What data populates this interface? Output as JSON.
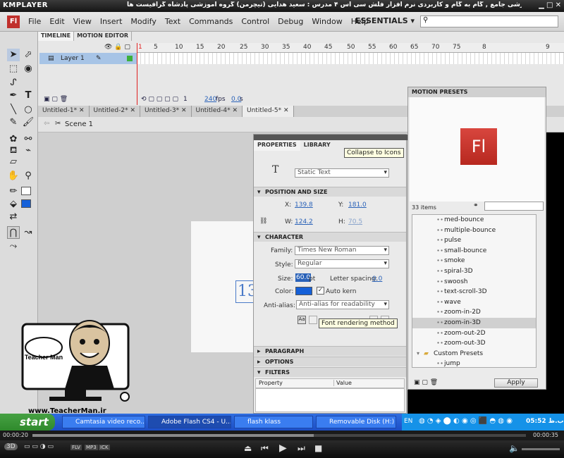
{
  "player": {
    "logo": "KMPLAYER",
    "caption": "مجموعه آموزشی جامع , گام به گام و کاربردی نرم افزار فلش سی اس ۴ مدرس : سعید هدایی (تیچرمن) گروه آموزشی پادشاه گرافیست ها",
    "time_elapsed": "00:00:20",
    "time_total": "00:00:35",
    "badges": [
      "FLV",
      "MP3",
      "ICK"
    ]
  },
  "app": {
    "logo": "Fl",
    "menus": [
      "File",
      "Edit",
      "View",
      "Insert",
      "Modify",
      "Text",
      "Commands",
      "Control",
      "Debug",
      "Window",
      "Help"
    ],
    "workspace": "ESSENTIALS"
  },
  "timeline": {
    "tabs": [
      "TIMELINE",
      "MOTION EDITOR"
    ],
    "layer_name": "Layer 1",
    "ruler": [
      "5",
      "10",
      "15",
      "20",
      "25",
      "30",
      "35",
      "40",
      "45",
      "50",
      "55",
      "60",
      "65",
      "70",
      "75",
      "8",
      "9"
    ],
    "current_frame": "1",
    "fps": "240",
    "fps_unit": "fps",
    "time": "0.0",
    "time_unit": "s"
  },
  "documents": {
    "tabs": [
      "Untitled-1*",
      "Untitled-2*",
      "Untitled-3*",
      "Untitled-4*",
      "Untitled-5*"
    ],
    "scene": "Scene 1"
  },
  "stage": {
    "text_preview": "13"
  },
  "properties": {
    "tabs": [
      "PROPERTIES",
      "LIBRARY"
    ],
    "text_icon": "T",
    "text_type": "Static Text",
    "position_size": {
      "header": "POSITION AND SIZE",
      "x_label": "X:",
      "x": "139.8",
      "y_label": "Y:",
      "y": "181.0",
      "w_label": "W:",
      "w": "124.2",
      "h_label": "H:",
      "h": "70.5"
    },
    "character": {
      "header": "CHARACTER",
      "family_label": "Family:",
      "family": "Times New Roman",
      "style_label": "Style:",
      "style": "Regular",
      "size_label": "Size:",
      "size": "60.0",
      "size_unit": "pt",
      "spacing_label": "Letter spacing:",
      "spacing": "0.0",
      "color_label": "Color:",
      "color": "#1560d8",
      "autokern_label": "Auto kern",
      "antialias_label": "Anti-alias:",
      "antialias": "Anti-alias for readability"
    },
    "sections": [
      "PARAGRAPH",
      "OPTIONS",
      "FILTERS"
    ],
    "filter_columns": [
      "Property",
      "Value"
    ],
    "tooltip_collapse": "Collapse to Icons",
    "tooltip_render": "Font rendering method"
  },
  "presets": {
    "title": "MOTION PRESETS",
    "preview_logo": "Fl",
    "count": "33 items",
    "items": [
      "med-bounce",
      "multiple-bounce",
      "pulse",
      "small-bounce",
      "smoke",
      "spiral-3D",
      "swoosh",
      "text-scroll-3D",
      "wave",
      "zoom-in-2D",
      "zoom-in-3D",
      "zoom-out-2D",
      "zoom-out-3D"
    ],
    "selected": "zoom-in-3D",
    "folder": "Custom Presets",
    "custom_items": [
      "jump"
    ],
    "apply": "Apply"
  },
  "brand": {
    "website": "www.TeacherMan.ir",
    "name": "Teacher Man"
  },
  "taskbar": {
    "start": "start",
    "tasks": [
      "Camtasia video reco...",
      "Adobe Flash CS4 - U...",
      "flash klass",
      "Removable Disk (H:)"
    ],
    "lang": "EN",
    "clock": "05:52 ب.ظ"
  }
}
